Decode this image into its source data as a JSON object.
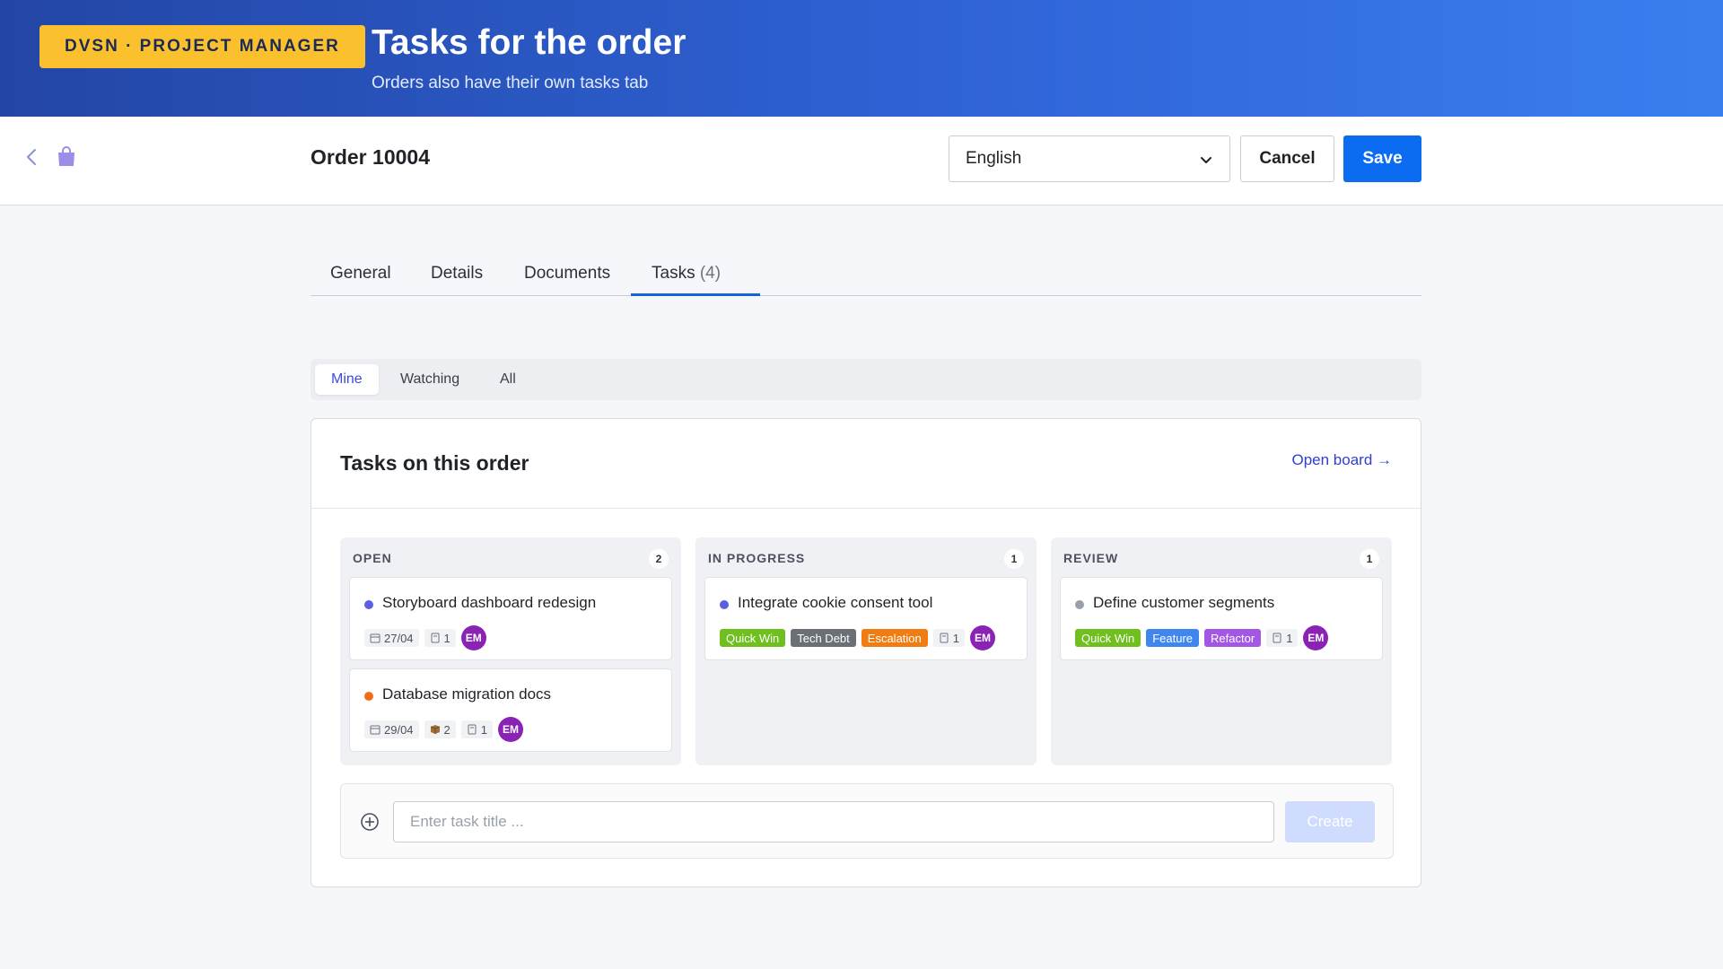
{
  "hero": {
    "brand": "DVSN · PROJECT MANAGER",
    "title": "Tasks for the order",
    "subtitle": "Orders also have their own tasks tab"
  },
  "toolbar": {
    "order_title": "Order 10004",
    "language": "English",
    "cancel_label": "Cancel",
    "save_label": "Save"
  },
  "tabs": [
    {
      "label": "General"
    },
    {
      "label": "Details"
    },
    {
      "label": "Documents"
    },
    {
      "label": "Tasks",
      "count": "(4)"
    }
  ],
  "filters": [
    "Mine",
    "Watching",
    "All"
  ],
  "card": {
    "title": "Tasks on this order",
    "open_board": "Open board →"
  },
  "columns": [
    {
      "name": "OPEN",
      "count": "2",
      "tasks": [
        {
          "title": "Storyboard dashboard redesign",
          "dot": "#5b5fe0",
          "date": "27/04",
          "checklist": "1",
          "avatar": "EM"
        },
        {
          "title": "Database migration docs",
          "dot": "#ef6c1a",
          "date": "29/04",
          "packages": "2",
          "checklist": "1",
          "avatar": "EM"
        }
      ]
    },
    {
      "name": "IN PROGRESS",
      "count": "1",
      "tasks": [
        {
          "title": "Integrate cookie consent tool",
          "dot": "#5b5fe0",
          "tags": [
            {
              "label": "Quick Win",
              "color": "#6fbf1f"
            },
            {
              "label": "Tech Debt",
              "color": "#6b6f76"
            },
            {
              "label": "Escalation",
              "color": "#f07d12"
            }
          ],
          "checklist": "1",
          "avatar": "EM"
        }
      ]
    },
    {
      "name": "REVIEW",
      "count": "1",
      "tasks": [
        {
          "title": "Define customer segments",
          "dot": "#9aa0a8",
          "tags": [
            {
              "label": "Quick Win",
              "color": "#6fbf1f"
            },
            {
              "label": "Feature",
              "color": "#3f86ef"
            },
            {
              "label": "Refactor",
              "color": "#a457e4"
            }
          ],
          "checklist": "1",
          "avatar": "EM"
        }
      ]
    }
  ],
  "create": {
    "placeholder": "Enter task title ...",
    "button_label": "Create"
  },
  "colors": {
    "accent": "#0b6cf2",
    "brand_badge": "#fbc02d",
    "avatar": "#8a23b5"
  },
  "icons": [
    "back-icon",
    "shopping-bag-icon",
    "chevron-down-icon",
    "calendar-icon",
    "checklist-icon",
    "package-icon",
    "plus-circle-icon",
    "arrow-right-icon"
  ]
}
